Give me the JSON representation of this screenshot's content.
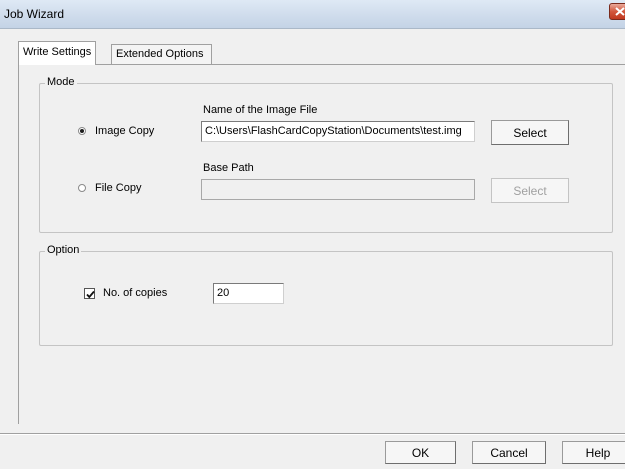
{
  "window": {
    "title": "Job Wizard"
  },
  "tabs": [
    {
      "label": "Write Settings",
      "active": true
    },
    {
      "label": "Extended Options",
      "active": false
    }
  ],
  "mode_group": {
    "label": "Mode",
    "image_copy": {
      "label": "Image Copy",
      "selected": true,
      "field_label": "Name of the Image File",
      "field_value": "C:\\Users\\FlashCardCopyStation\\Documents\\test.img",
      "select_label": "Select"
    },
    "file_copy": {
      "label": "File Copy",
      "selected": false,
      "field_label": "Base Path",
      "field_value": "",
      "select_label": "Select"
    }
  },
  "option_group": {
    "label": "Option",
    "copies": {
      "label": "No. of copies",
      "checked": true,
      "value": "20"
    }
  },
  "footer": {
    "ok_label": "OK",
    "cancel_label": "Cancel",
    "help_label": "Help"
  },
  "icons": {
    "close": "close-icon",
    "check": "checkmark-icon"
  }
}
